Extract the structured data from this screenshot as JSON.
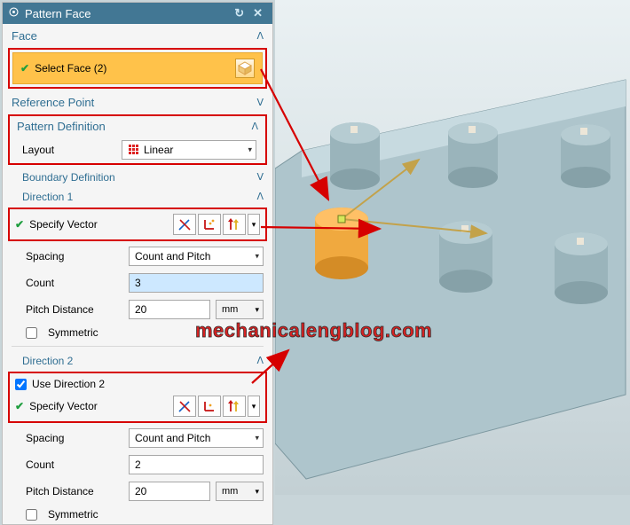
{
  "title": "Pattern Face",
  "sections": {
    "face": "Face",
    "refpoint": "Reference Point",
    "patdef": "Pattern Definition",
    "boundarydef": "Boundary Definition",
    "dir1": "Direction 1",
    "dir2": "Direction 2"
  },
  "face_row": {
    "label": "Select Face (2)"
  },
  "layout": {
    "label": "Layout",
    "value": "Linear"
  },
  "specify_vector": "Specify Vector",
  "dir1_fields": {
    "spacing_label": "Spacing",
    "spacing_value": "Count and Pitch",
    "count_label": "Count",
    "count_value": "3",
    "pitch_label": "Pitch Distance",
    "pitch_value": "20",
    "pitch_unit": "mm",
    "symmetric": "Symmetric"
  },
  "dir2_fields": {
    "use_dir2": "Use Direction 2",
    "spacing_label": "Spacing",
    "spacing_value": "Count and Pitch",
    "count_label": "Count",
    "count_value": "2",
    "pitch_label": "Pitch Distance",
    "pitch_value": "20",
    "pitch_unit": "mm",
    "symmetric": "Symmetric"
  },
  "watermark": "mechanicalengblog.com"
}
